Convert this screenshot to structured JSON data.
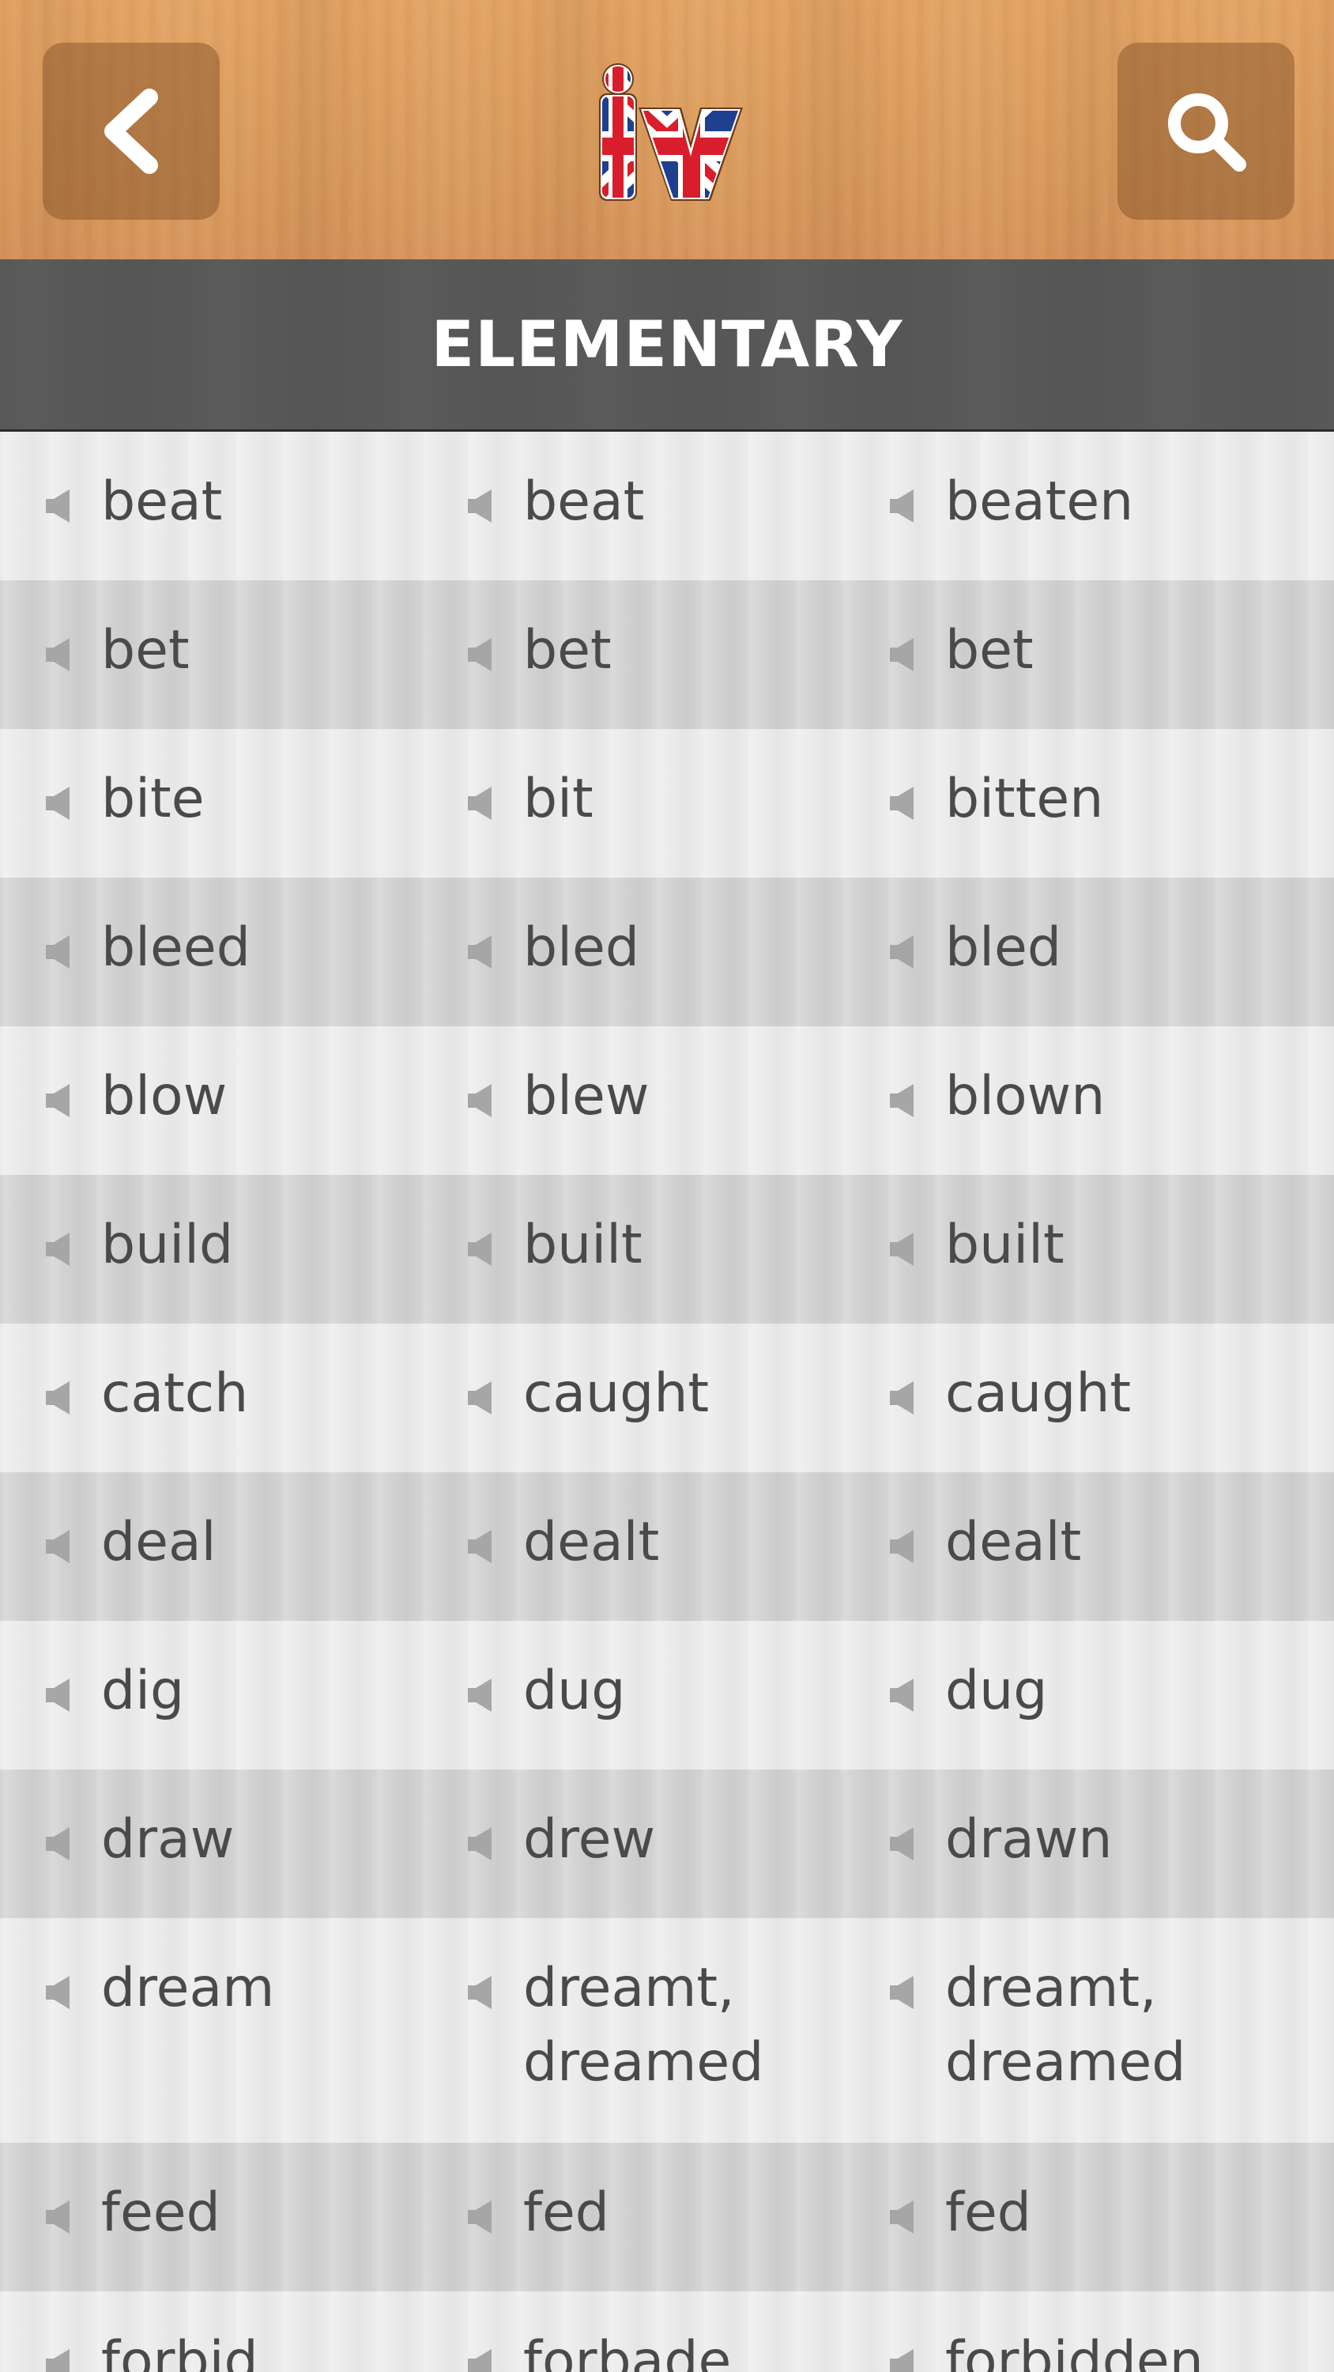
{
  "header": {
    "back_icon": "chevron-left-icon",
    "logo_text": "iv",
    "search_icon": "search-icon"
  },
  "section": {
    "title": "ELEMENTARY"
  },
  "verbs": [
    [
      "beat",
      "beat",
      "beaten"
    ],
    [
      "bet",
      "bet",
      "bet"
    ],
    [
      "bite",
      "bit",
      "bitten"
    ],
    [
      "bleed",
      "bled",
      "bled"
    ],
    [
      "blow",
      "blew",
      "blown"
    ],
    [
      "build",
      "built",
      "built"
    ],
    [
      "catch",
      "caught",
      "caught"
    ],
    [
      "deal",
      "dealt",
      "dealt"
    ],
    [
      "dig",
      "dug",
      "dug"
    ],
    [
      "draw",
      "drew",
      "drawn"
    ],
    [
      "dream",
      "dreamt,\ndreamed",
      "dreamt,\ndreamed"
    ],
    [
      "feed",
      "fed",
      "fed"
    ],
    [
      "forbid",
      "forbade",
      "forbidden"
    ]
  ],
  "colors": {
    "wood": "#d99a5c",
    "header_dark": "#585858",
    "row_light": "#ebebeb",
    "row_dark": "#d2d2d2",
    "text": "#4a4a4a",
    "flag_red": "#d81e2c",
    "flag_blue": "#1f3f8f"
  }
}
